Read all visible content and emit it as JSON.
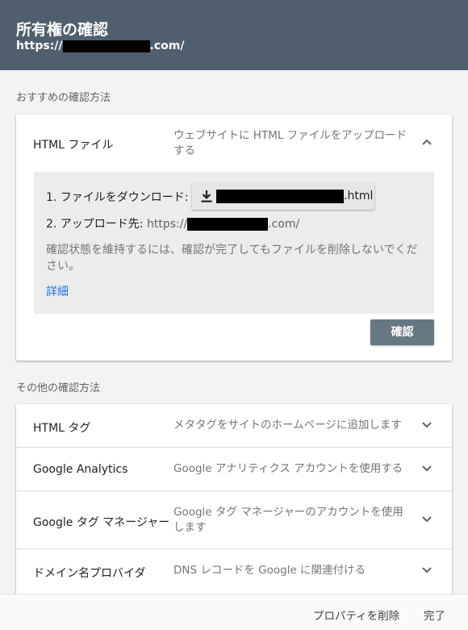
{
  "header": {
    "title": "所有権の確認",
    "url_prefix": "https://",
    "url_suffix": ".com/"
  },
  "recommended": {
    "section_label": "おすすめの確認方法",
    "method": {
      "title": "HTML ファイル",
      "description": "ウェブサイトに HTML ファイルをアップロードする",
      "chevron_icon": "chevron-up-icon"
    },
    "step1_label": "1. ファイルをダウンロード:",
    "download_icon": "download-icon",
    "download_ext": ".html",
    "step2_label": "2. アップロード先:",
    "step2_url_prefix": "https://",
    "step2_url_suffix": ".com/",
    "note": "確認状態を維持するには、確認が完了してもファイルを削除しないでください。",
    "details_link": "詳細",
    "confirm_button": "確認"
  },
  "other": {
    "section_label": "その他の確認方法",
    "methods": [
      {
        "title": "HTML タグ",
        "description": "メタタグをサイトのホームページに追加します"
      },
      {
        "title": "Google Analytics",
        "description": "Google アナリティクス アカウントを使用する"
      },
      {
        "title": "Google タグ マネージャー",
        "description": "Google タグ マネージャーのアカウントを使用します"
      },
      {
        "title": "ドメイン名プロバイダ",
        "description": "DNS レコードを Google に関連付ける"
      }
    ]
  },
  "footer": {
    "delete_property": "プロパティを削除",
    "done": "完了"
  }
}
